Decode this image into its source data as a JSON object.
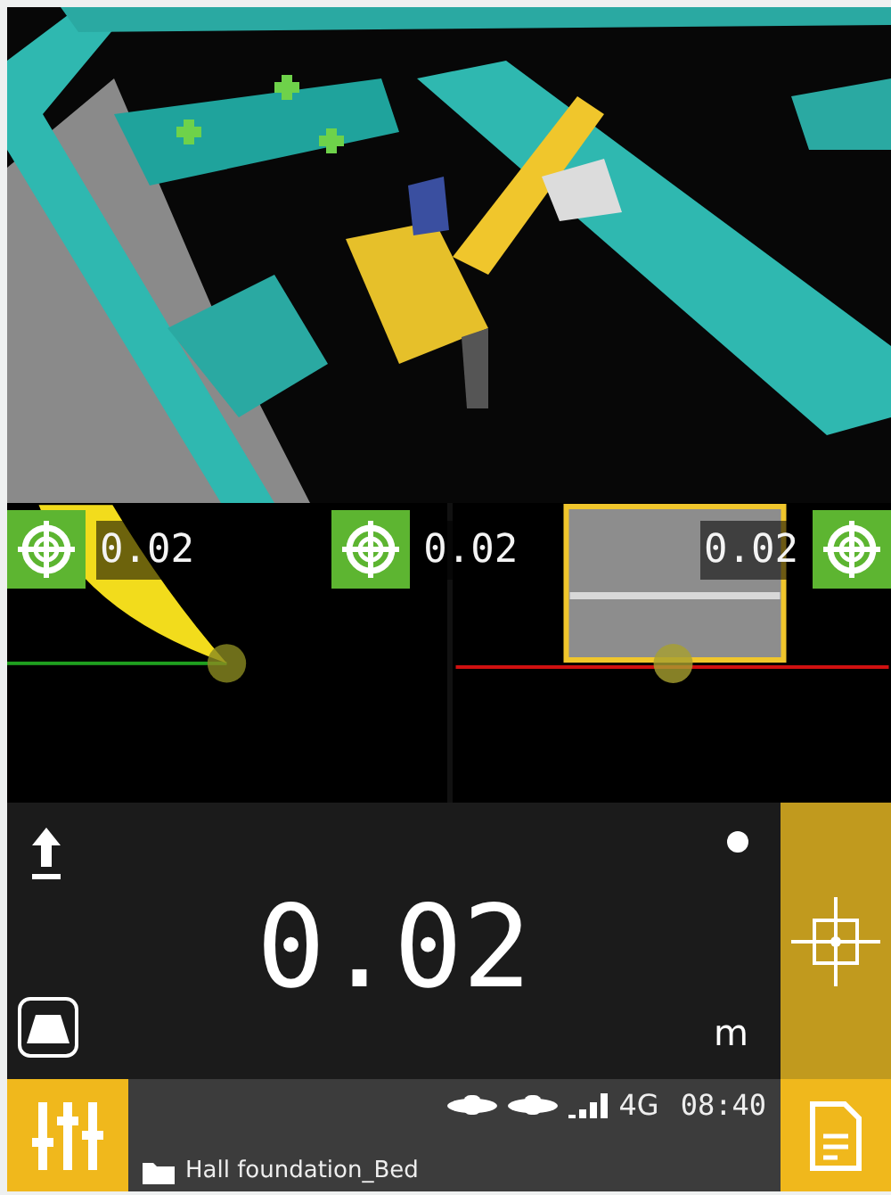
{
  "section_readouts": [
    {
      "value": "0.02"
    },
    {
      "value": "0.02"
    },
    {
      "value": "0.02"
    }
  ],
  "main_readout": {
    "value": "0.02",
    "unit": "m"
  },
  "status_bar": {
    "network": "4G",
    "time": "08:40",
    "project": "Hall foundation_Bed"
  }
}
